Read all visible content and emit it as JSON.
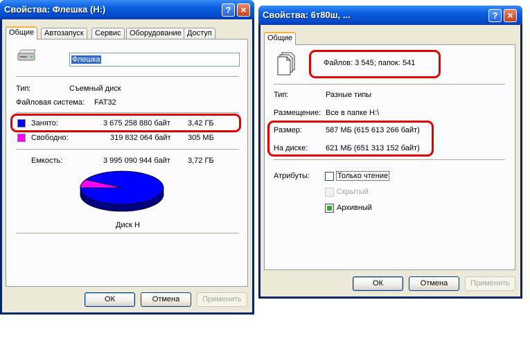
{
  "left_window": {
    "title": "Свойства: Флешка (H:)",
    "help_label": "?",
    "close_label": "×",
    "tabs": [
      "Общие",
      "Автозапуск",
      "Сервис",
      "Оборудование",
      "Доступ"
    ],
    "name_value": "Флешка",
    "type_label": "Тип:",
    "type_value": "Съемный диск",
    "fs_label": "Файловая система:",
    "fs_value": "FAT32",
    "used_label": "Занято:",
    "used_bytes": "3 675 258 880 байт",
    "used_size": "3,42 ГБ",
    "free_label": "Свободно:",
    "free_bytes": "319 832 064 байт",
    "free_size": "305 МБ",
    "capacity_label": "Емкость:",
    "capacity_bytes": "3 995 090 944 байт",
    "capacity_size": "3,72 ГБ",
    "disk_label": "Диск H",
    "used_fraction": 0.92,
    "colors": {
      "used": "#0000ff",
      "free": "#ff00ff"
    },
    "buttons": {
      "ok": "ОК",
      "cancel": "Отмена",
      "apply": "Применить"
    }
  },
  "right_window": {
    "title": "Свойства: 6т80ш, ...",
    "help_label": "?",
    "close_label": "×",
    "tab": "Общие",
    "files_summary": "Файлов: 3 545; папок: 541",
    "type_label": "Тип:",
    "type_value": "Разные типы",
    "location_label": "Размещение:",
    "location_value": "Все в папке H:\\",
    "size_label": "Размер:",
    "size_value": "587 МБ (615 613 266 байт)",
    "ondisk_label": "На диске:",
    "ondisk_value": "621 МБ (651 313 152 байт)",
    "attributes_label": "Атрибуты:",
    "attributes": [
      {
        "label": "Только чтение",
        "checked": false,
        "disabled": false
      },
      {
        "label": "Скрытый",
        "checked": false,
        "disabled": true
      },
      {
        "label": "Архивный",
        "checked": true,
        "disabled": false
      }
    ],
    "buttons": {
      "ok": "ОК",
      "cancel": "Отмена",
      "apply": "Применить"
    }
  }
}
